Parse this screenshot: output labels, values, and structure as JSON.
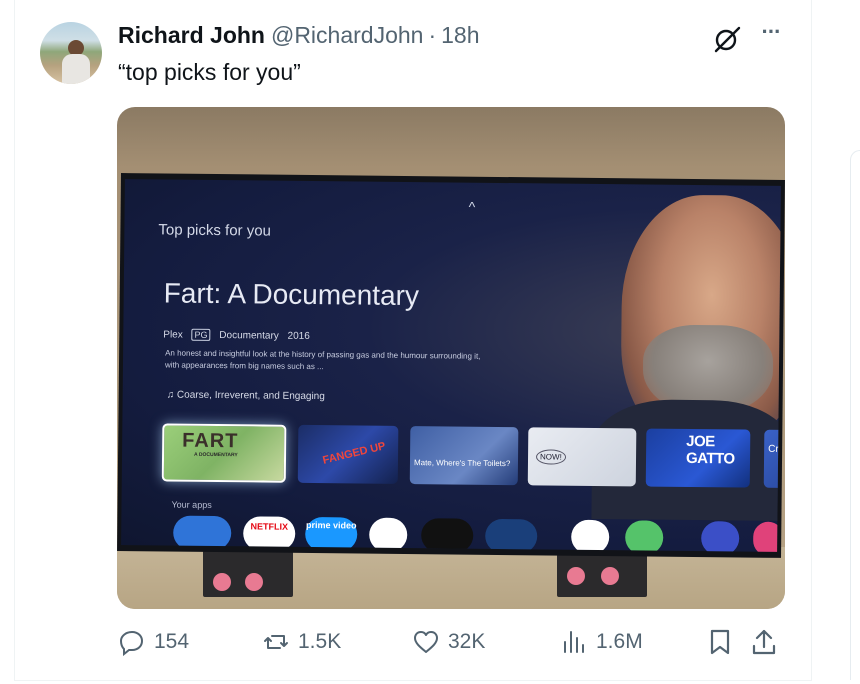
{
  "tweet": {
    "author_name": "Richard John",
    "author_handle": "@RichardJohn",
    "separator": "·",
    "timestamp": "18h",
    "text": "“top picks for you”"
  },
  "tv_screen": {
    "section_label": "Top picks for you",
    "title": "Fart: A Documentary",
    "provider": "Plex",
    "rating": "PG",
    "genre": "Documentary",
    "year": "2016",
    "description": "An honest and insightful look at the history of passing gas and the humour surrounding it, with appearances from big names such as ...",
    "tags": "Coarse, Irreverent, and Engaging",
    "apps_label": "Your apps",
    "tiles": [
      {
        "title": "FART",
        "subtitle": "A DOCUMENTARY"
      },
      {
        "title": "FANGED UP"
      },
      {
        "title": "Mate, Where's The Toilets?"
      },
      {
        "title": "NOW!"
      },
      {
        "title": "JOE GATTO"
      },
      {
        "title": "Cru"
      }
    ],
    "apps": [
      "NETFLIX",
      "prime video",
      "YouTube",
      "Apple TV",
      "",
      "",
      "BT",
      ""
    ]
  },
  "actions": {
    "replies": "154",
    "reposts": "1.5K",
    "likes": "32K",
    "views": "1.6M"
  },
  "colors": {
    "text_primary": "#0f1419",
    "text_secondary": "#536471",
    "border": "#eff3f4"
  },
  "icons": [
    "grok-icon",
    "more-icon",
    "reply-icon",
    "repost-icon",
    "like-icon",
    "views-icon",
    "bookmark-icon",
    "share-icon"
  ]
}
